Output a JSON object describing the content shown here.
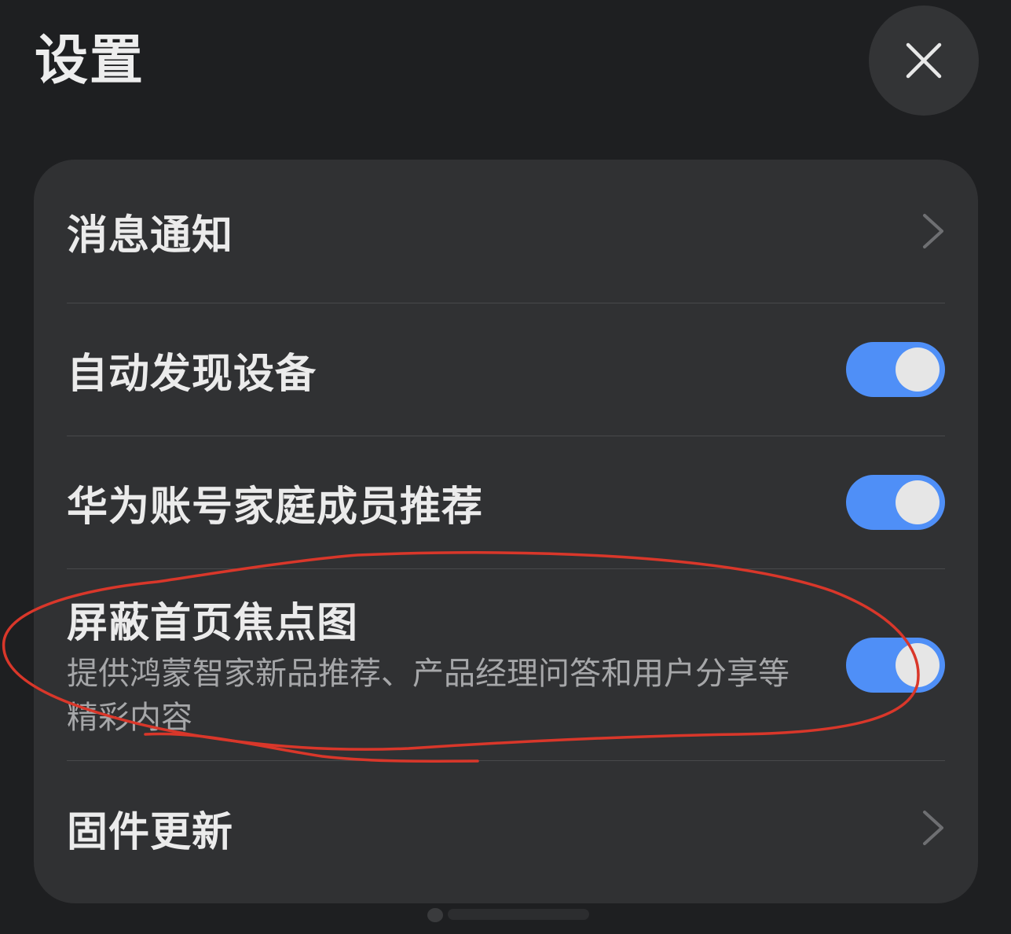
{
  "header": {
    "title": "设置",
    "close_icon": "close-icon"
  },
  "settings": {
    "items": [
      {
        "label": "消息通知",
        "control": "chevron",
        "icon": "chevron-right-icon"
      },
      {
        "label": "自动发现设备",
        "control": "toggle",
        "enabled": true
      },
      {
        "label": "华为账号家庭成员推荐",
        "control": "toggle",
        "enabled": true
      },
      {
        "label": "屏蔽首页焦点图",
        "description": "提供鸿蒙智家新品推荐、产品经理问答和用户分享等精彩内容",
        "control": "toggle",
        "enabled": true
      },
      {
        "label": "固件更新",
        "control": "chevron",
        "icon": "chevron-right-icon"
      }
    ]
  },
  "colors": {
    "background": "#1e1f21",
    "card": "#303133",
    "toggle_on": "#4f8ff7",
    "annotation": "#d9372a"
  }
}
